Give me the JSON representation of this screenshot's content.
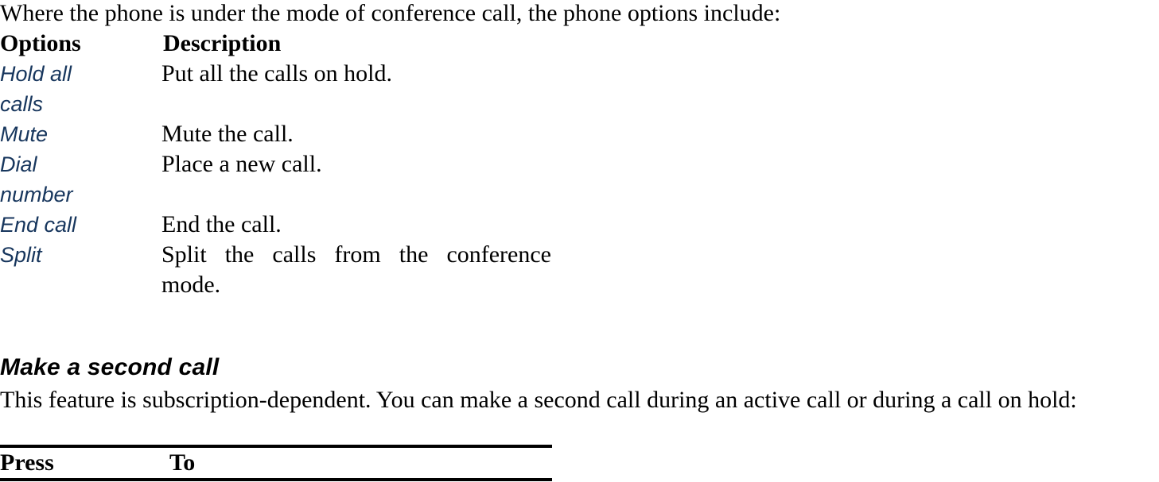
{
  "document": {
    "intro_line": "Where the phone is under the mode of conference call, the phone options include:",
    "options_table": {
      "headers": {
        "col_a": "Options",
        "col_b": "Description"
      },
      "rows": [
        {
          "option": "Hold all calls",
          "description": "Put all the calls on hold."
        },
        {
          "option": "Mute",
          "description": "Mute the call."
        },
        {
          "option": "Dial number",
          "description": "Place a new call."
        },
        {
          "option": "End call",
          "description": "End the call."
        },
        {
          "option": "Split",
          "description": "Split the calls from the conference mode."
        }
      ]
    },
    "section": {
      "heading": "Make a second call",
      "paragraph": "This feature is subscription-dependent. You can make a second call during an active call or during a call on hold:"
    },
    "press_table": {
      "headers": {
        "col_a": "Press",
        "col_b": "To"
      }
    }
  },
  "colors": {
    "option_blue": "#17365D",
    "text_black": "#000000",
    "page_background": "#FFFFFF"
  }
}
